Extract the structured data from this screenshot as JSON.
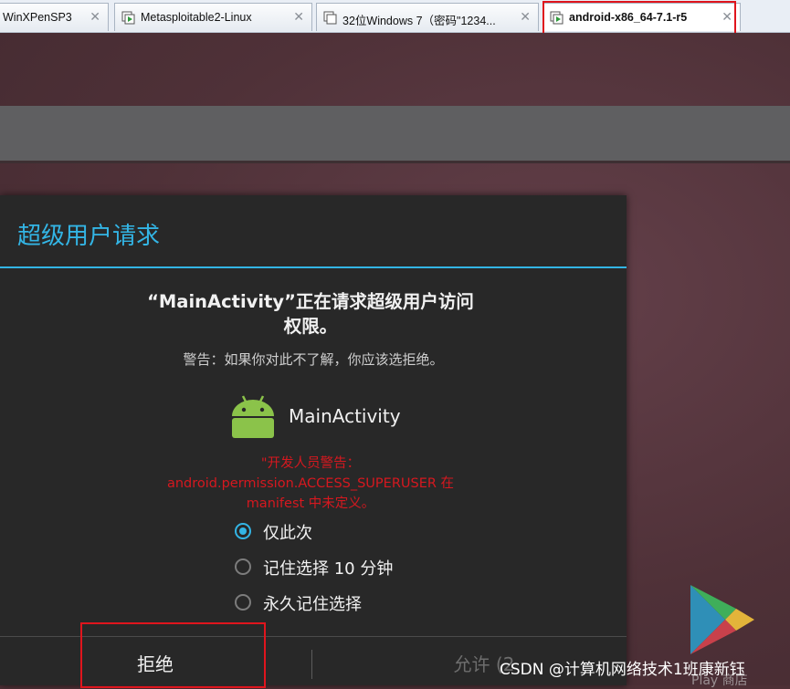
{
  "tabs": [
    {
      "label": "WinXPenSP3"
    },
    {
      "label": "Metasploitable2-Linux"
    },
    {
      "label": "32位Windows 7（密码\"1234..."
    },
    {
      "label": "android-x86_64-7.1-r5"
    }
  ],
  "dialog": {
    "title": "超级用户请求",
    "request_line1": "“MainActivity”正在请求超级用户访问",
    "request_line2": "权限。",
    "warning": "警告：如果你对此不了解，你应该选拒绝。",
    "app_name": "MainActivity",
    "dev_warning_line1": "\"开发人员警告：",
    "dev_warning_line2": "android.permission.ACCESS_SUPERUSER 在",
    "dev_warning_line3": "manifest 中未定义。",
    "options": [
      {
        "label": "仅此次",
        "selected": true
      },
      {
        "label": "记住选择 10 分钟",
        "selected": false
      },
      {
        "label": "永久记住选择",
        "selected": false
      }
    ],
    "deny_label": "拒绝",
    "allow_label": "允许 (2"
  },
  "background": {
    "play_store_label": "Play 商店"
  },
  "watermark": "CSDN @计算机网络技术1班康新钰",
  "colors": {
    "accent": "#33b5e5",
    "warning_red": "#d6181f",
    "highlight_red": "#e0151d"
  }
}
